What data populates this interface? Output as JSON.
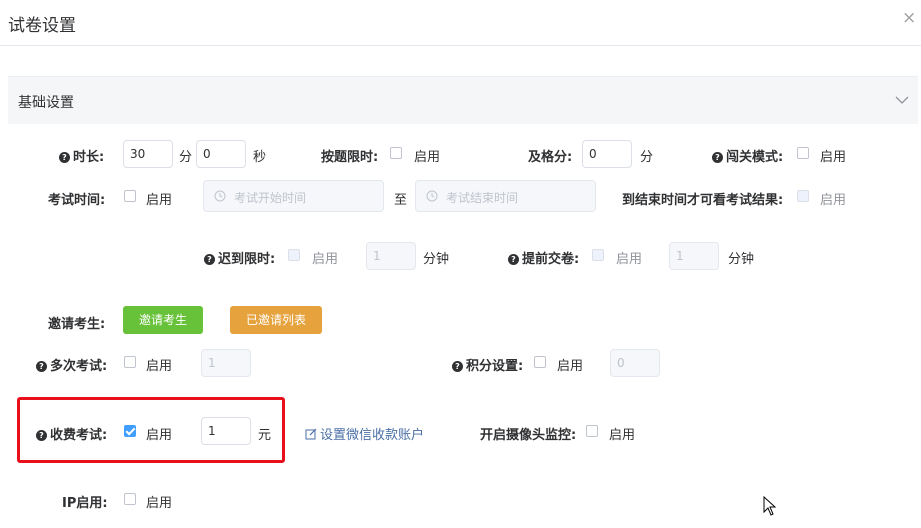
{
  "dialog": {
    "title": "试卷设置",
    "close_icon": "×"
  },
  "section": {
    "title": "基础设置"
  },
  "row1": {
    "duration_label": "时长:",
    "duration_value": "30",
    "minute_unit": "分",
    "seconds_value": "0",
    "second_unit": "秒",
    "per_question_label": "按题限时:",
    "enable": "启用",
    "pass_label": "及格分:",
    "pass_value": "0",
    "pass_unit": "分",
    "level_mode_label": "闯关模式:"
  },
  "row2": {
    "exam_time_label": "考试时间:",
    "enable": "启用",
    "start_placeholder": "考试开始时间",
    "to": "至",
    "end_placeholder": "考试结束时间",
    "view_result_label": "到结束时间才可看考试结果:"
  },
  "row3": {
    "late_label": "迟到限时:",
    "enable": "启用",
    "late_value": "1",
    "late_unit": "分钟",
    "early_label": "提前交卷:",
    "early_value": "1",
    "early_unit": "分钟"
  },
  "row4": {
    "invite_label": "邀请考生:",
    "invite_button": "邀请考生",
    "invited_list_button": "已邀请列表"
  },
  "row5": {
    "multi_label": "多次考试:",
    "enable": "启用",
    "multi_value": "1",
    "points_label": "积分设置:",
    "points_value": "0"
  },
  "row6": {
    "fee_label": "收费考试:",
    "enable": "启用",
    "fee_value": "1",
    "fee_unit": "元",
    "wechat_link": "设置微信收款账户",
    "camera_label": "开启摄像头监控:"
  },
  "row7": {
    "ip_label": "IP启用:",
    "enable": "启用"
  },
  "colors": {
    "accent": "#409eff",
    "green": "#67c23a",
    "orange": "#e6a23c",
    "highlight": "#e8111b"
  }
}
